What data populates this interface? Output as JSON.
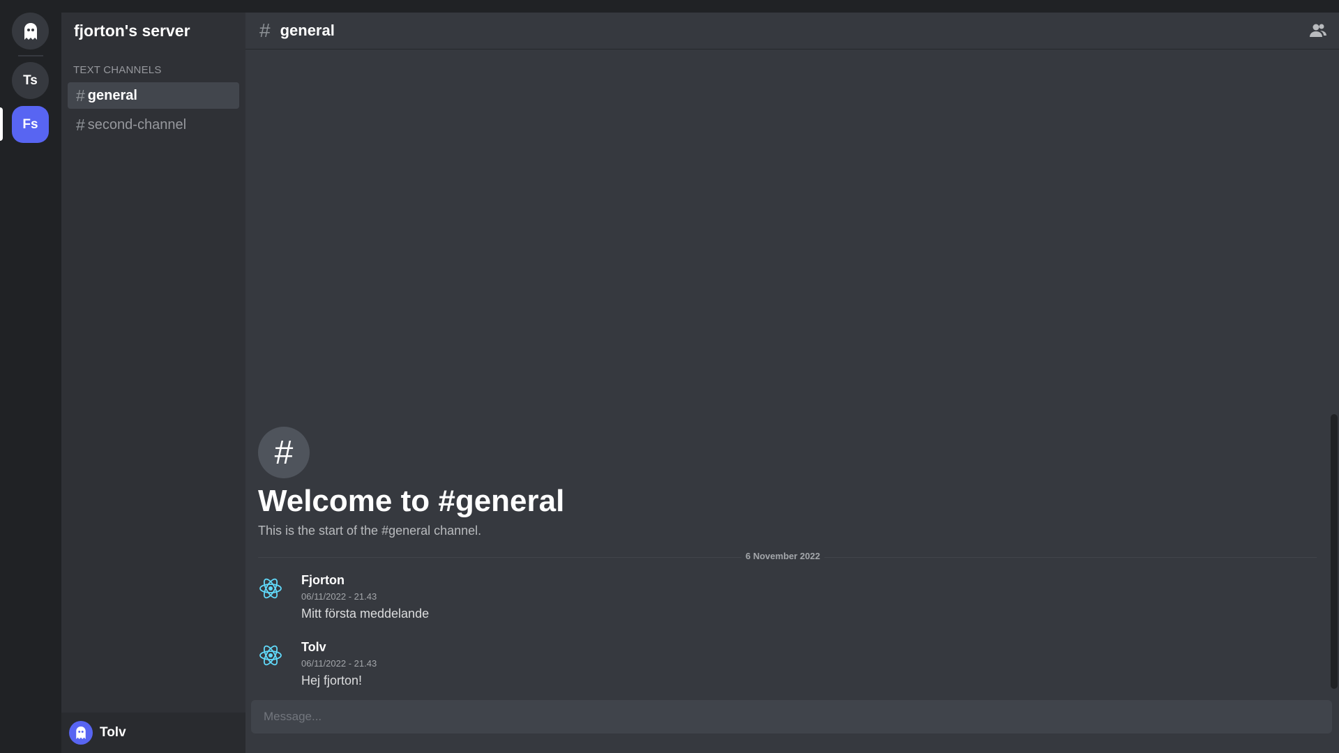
{
  "rail": {
    "home_icon": "ghost-icon",
    "servers": [
      {
        "abbr": "Ts"
      },
      {
        "abbr": "Fs",
        "active": true
      }
    ],
    "active_color": "#5865f2"
  },
  "sidebar": {
    "server_name": "fjorton's server",
    "section_label": "TEXT CHANNELS",
    "channels": [
      {
        "label": "general",
        "active": true
      },
      {
        "label": "second-channel",
        "active": false
      }
    ]
  },
  "user_panel": {
    "name": "Tolv",
    "avatar_icon": "ghost-icon"
  },
  "channel_header": {
    "name": "general",
    "members_icon": "members-icon"
  },
  "welcome": {
    "icon_glyph": "#",
    "title": "Welcome to #general",
    "subtitle": "This is the start of the #general channel."
  },
  "date_divider": "6 November 2022",
  "messages": [
    {
      "author": "Fjorton",
      "timestamp": "06/11/2022 - 21.43",
      "text": "Mitt första meddelande",
      "avatar_icon": "react-atom-icon"
    },
    {
      "author": "Tolv",
      "timestamp": "06/11/2022 - 21.43",
      "text": "Hej fjorton!",
      "avatar_icon": "react-atom-icon"
    }
  ],
  "composer": {
    "placeholder": "Message..."
  }
}
